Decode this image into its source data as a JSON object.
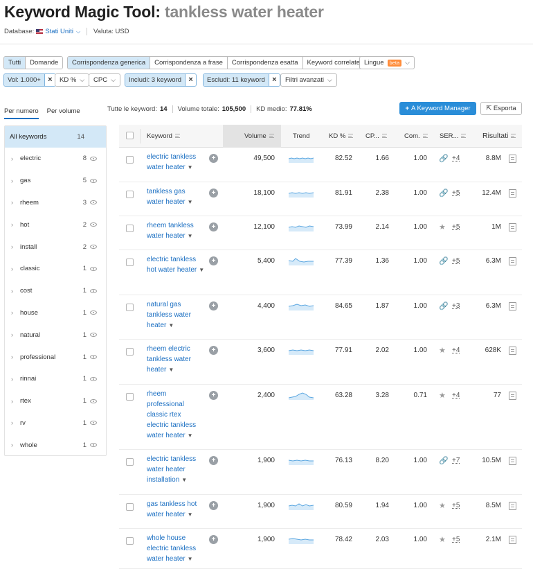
{
  "header": {
    "title": "Keyword Magic Tool:",
    "query": "tankless water heater",
    "database_label": "Database:",
    "database_value": "Stati Uniti",
    "currency_label": "Valuta: USD"
  },
  "match_tabs": [
    "Tutti",
    "Domande"
  ],
  "match_types": [
    "Corrispondenza generica",
    "Corrispondenza a frase",
    "Corrispondenza esatta",
    "Keyword correlate"
  ],
  "languages": {
    "label": "Lingue",
    "badge": "beta"
  },
  "filters": {
    "volume": "Vol: 1.000+",
    "kd": "KD %",
    "cpc": "CPC",
    "include": "Includi: 3 keyword",
    "exclude": "Escludi: 11 keyword",
    "advanced": "Filtri avanzati"
  },
  "view_tabs": [
    "Per numero",
    "Per volume"
  ],
  "summary": {
    "all_label": "Tutte le keyword:",
    "all_value": "14",
    "volume_label": "Volume totale:",
    "volume_value": "105,500",
    "kd_label": "KD medio:",
    "kd_value": "77.81%"
  },
  "actions": {
    "add": "A Keyword Manager",
    "add_icon": "+",
    "export": "Esporta"
  },
  "sidebar": {
    "header": {
      "label": "All keywords",
      "count": "14"
    },
    "items": [
      {
        "label": "electric",
        "count": "8"
      },
      {
        "label": "gas",
        "count": "5"
      },
      {
        "label": "rheem",
        "count": "3"
      },
      {
        "label": "hot",
        "count": "2"
      },
      {
        "label": "install",
        "count": "2"
      },
      {
        "label": "classic",
        "count": "1"
      },
      {
        "label": "cost",
        "count": "1"
      },
      {
        "label": "house",
        "count": "1"
      },
      {
        "label": "natural",
        "count": "1"
      },
      {
        "label": "professional",
        "count": "1"
      },
      {
        "label": "rinnai",
        "count": "1"
      },
      {
        "label": "rtex",
        "count": "1"
      },
      {
        "label": "rv",
        "count": "1"
      },
      {
        "label": "whole",
        "count": "1"
      }
    ]
  },
  "table": {
    "columns": [
      "Keyword",
      "Volume",
      "Trend",
      "KD %",
      "CP...",
      "Com.",
      "SER...",
      "Risultati"
    ],
    "rows": [
      {
        "keyword": "electric tankless water heater",
        "volume": "49,500",
        "kd": "82.52",
        "cpc": "1.66",
        "com": "1.00",
        "serp_icon": "link-icon",
        "serp": "+4",
        "results": "8.8M"
      },
      {
        "keyword": "tankless gas water heater",
        "volume": "18,100",
        "kd": "81.91",
        "cpc": "2.38",
        "com": "1.00",
        "serp_icon": "link-icon",
        "serp": "+5",
        "results": "12.4M"
      },
      {
        "keyword": "rheem tankless water heater",
        "volume": "12,100",
        "kd": "73.99",
        "cpc": "2.14",
        "com": "1.00",
        "serp_icon": "star-icon",
        "serp": "+5",
        "results": "1M"
      },
      {
        "keyword": "electric tankless hot water heater",
        "volume": "5,400",
        "kd": "77.39",
        "cpc": "1.36",
        "com": "1.00",
        "serp_icon": "link-icon",
        "serp": "+5",
        "results": "6.3M"
      },
      {
        "keyword": "natural gas tankless water heater",
        "volume": "4,400",
        "kd": "84.65",
        "cpc": "1.87",
        "com": "1.00",
        "serp_icon": "link-icon",
        "serp": "+3",
        "results": "6.3M"
      },
      {
        "keyword": "rheem electric tankless water heater",
        "volume": "3,600",
        "kd": "77.91",
        "cpc": "2.02",
        "com": "1.00",
        "serp_icon": "star-icon",
        "serp": "+4",
        "results": "628K"
      },
      {
        "keyword": "rheem professional classic rtex electric tankless water heater",
        "volume": "2,400",
        "kd": "63.28",
        "cpc": "3.28",
        "com": "0.71",
        "serp_icon": "star-icon",
        "serp": "+4",
        "results": "77"
      },
      {
        "keyword": "electric tankless water heater installation",
        "volume": "1,900",
        "kd": "76.13",
        "cpc": "8.20",
        "com": "1.00",
        "serp_icon": "link-icon",
        "serp": "+7",
        "results": "10.5M"
      },
      {
        "keyword": "gas tankless hot water heater",
        "volume": "1,900",
        "kd": "80.59",
        "cpc": "1.94",
        "com": "1.00",
        "serp_icon": "star-icon",
        "serp": "+5",
        "results": "8.5M"
      },
      {
        "keyword": "whole house electric tankless water heater",
        "volume": "1,900",
        "kd": "78.42",
        "cpc": "2.03",
        "com": "1.00",
        "serp_icon": "star-icon",
        "serp": "+5",
        "results": "2.1M"
      }
    ]
  },
  "colors": {
    "link": "#1b6fc2",
    "selected_bg": "#d3e8f7",
    "primary_button": "#2a8dd8",
    "beta_badge": "#ff8c3a",
    "trend_line": "#5aa6e0",
    "trend_fill": "#d6eaf9"
  }
}
